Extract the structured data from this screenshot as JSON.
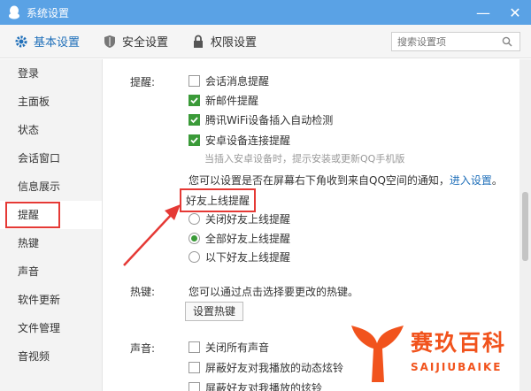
{
  "window": {
    "title": "系统设置",
    "controls": {
      "minimize": "—",
      "close": "✕"
    }
  },
  "toolbar": {
    "tabs": [
      {
        "label": "基本设置",
        "icon": "gear-icon"
      },
      {
        "label": "安全设置",
        "icon": "shield-icon"
      },
      {
        "label": "权限设置",
        "icon": "lock-icon"
      }
    ],
    "search_placeholder": "搜索设置项"
  },
  "sidebar": {
    "items": [
      "登录",
      "主面板",
      "状态",
      "会话窗口",
      "信息展示",
      "提醒",
      "热键",
      "声音",
      "软件更新",
      "文件管理",
      "音视频"
    ],
    "active_index": 5
  },
  "content": {
    "reminder": {
      "label": "提醒:",
      "options": [
        {
          "label": "会话消息提醒",
          "checked": false
        },
        {
          "label": "新邮件提醒",
          "checked": true
        },
        {
          "label": "腾讯WiFi设备插入自动检测",
          "checked": true
        },
        {
          "label": "安卓设备连接提醒",
          "checked": true
        }
      ],
      "android_hint": "当插入安卓设备时，提示安装或更新QQ手机版",
      "notify_text": "您可以设置是否在屏幕右下角收到来自QQ空间的通知，",
      "notify_link": "进入设置",
      "notify_end": "。",
      "friend_online_title": "好友上线提醒",
      "friend_online_options": [
        {
          "label": "关闭好友上线提醒",
          "checked": false
        },
        {
          "label": "全部好友上线提醒",
          "checked": true
        },
        {
          "label": "以下好友上线提醒",
          "checked": false
        }
      ]
    },
    "hotkey": {
      "label": "热键:",
      "desc": "您可以通过点击选择要更改的热键。",
      "button": "设置热键"
    },
    "sound": {
      "label": "声音:",
      "options": [
        {
          "label": "关闭所有声音",
          "checked": false
        },
        {
          "label": "屏蔽好友对我播放的动态炫铃",
          "checked": false
        },
        {
          "label": "屏蔽好友对我播放的炫铃",
          "checked": false
        }
      ]
    }
  },
  "watermark": {
    "title": "赛玖百科",
    "subtitle": "SAIJIUBAIKE"
  },
  "colors": {
    "accent": "#5aa2e5",
    "checkbox": "#3a9a38",
    "highlight": "#e53935",
    "watermark": "#f1531d"
  }
}
